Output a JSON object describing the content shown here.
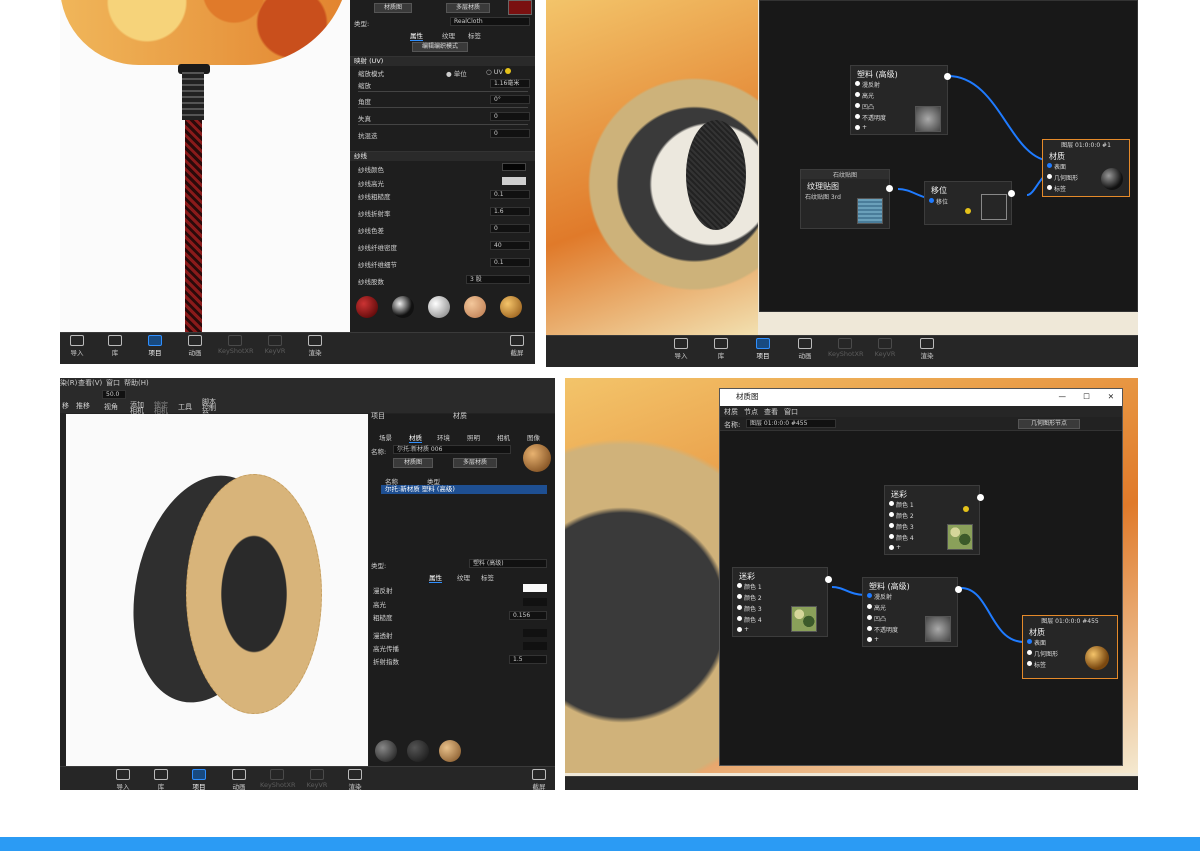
{
  "colors": {
    "accent": "#2f8fff",
    "bottom_bar": "#2b9bf4",
    "node_selected_border": "#e58a2a",
    "wire": "#1f7bff"
  },
  "p1": {
    "material_graph_btn": "材质图",
    "multilayer_btn": "多层材质",
    "type_label": "类型:",
    "type_value": "RealCloth",
    "tabs": [
      "属性",
      "纹理",
      "标签"
    ],
    "edit_weave_btn": "编辑编织模式",
    "section_mapping": "映射 (UV)",
    "scale_mode_label": "缩放模式",
    "scale_mode_opt1": "单位",
    "scale_mode_opt2": "UV",
    "rows_mapping": [
      {
        "label": "缩放",
        "value": "1.16毫米"
      },
      {
        "label": "角度",
        "value": "0°"
      },
      {
        "label": "失真",
        "value": "0"
      },
      {
        "label": "抗混迭",
        "value": "0"
      }
    ],
    "section_yarn": "纱线",
    "rows_yarn": [
      {
        "label": "纱线颜色",
        "value": ""
      },
      {
        "label": "纱线高光",
        "value": ""
      },
      {
        "label": "纱线粗糙度",
        "value": "0.1"
      },
      {
        "label": "纱线折射率",
        "value": "1.6"
      },
      {
        "label": "纱线色差",
        "value": "0"
      },
      {
        "label": "纱线纤维密度",
        "value": "40"
      },
      {
        "label": "纱线纤维细节",
        "value": "0.1"
      },
      {
        "label": "纱线股数",
        "value": "3 股"
      }
    ],
    "toolbar": [
      "导入",
      "库",
      "项目",
      "动画",
      "KeyShotXR",
      "KeyVR",
      "渲染"
    ],
    "toolbar_active": "项目",
    "screenshot_label": "截屏"
  },
  "p2": {
    "node_plastic_title": "塑料 (高级)",
    "node_plastic_ports": [
      "漫反射",
      "高光",
      "凹凸",
      "不透明度",
      "+"
    ],
    "node_texture_header": "石纹贴图",
    "node_texture_title": "纹理贴图",
    "node_texture_file": "石纹贴图 3rd",
    "node_shift_title": "移位",
    "node_shift_port": "移位",
    "node_material_header": "图层 01:0:0:0 #1",
    "node_material_title": "材质",
    "node_material_ports": [
      "表面",
      "几何图形",
      "标签"
    ],
    "toolbar": [
      "导入",
      "库",
      "项目",
      "动画",
      "KeyShotXR",
      "KeyVR",
      "渲染"
    ]
  },
  "p3": {
    "menu": [
      "染(R)",
      "查看(V)",
      "窗口",
      "帮助(H)"
    ],
    "toolbar_items": [
      "移",
      "推移",
      "视角",
      "添加相机",
      "锁定相机",
      "工具",
      "脚本控制台"
    ],
    "zoom_value": "50.0",
    "panel_left_title": "项目",
    "panel_title": "材质",
    "tabs": [
      "场景",
      "材质",
      "环境",
      "照明",
      "相机",
      "图像"
    ],
    "name_label": "名称:",
    "name_value": "尔托:新材质 006",
    "material_graph_btn": "材质图",
    "multilayer_btn": "多层材质",
    "list_headers": [
      "名称",
      "类型"
    ],
    "list_row": "尔托:新材质 塑料 (高级)",
    "type_label": "类型:",
    "type_value": "塑料 (高级)",
    "prop_tabs": [
      "属性",
      "纹理",
      "标签"
    ],
    "props": [
      {
        "label": "漫反射",
        "value": ""
      },
      {
        "label": "高光",
        "value": ""
      },
      {
        "label": "粗糙度",
        "value": "0.156"
      },
      {
        "label": "漫透射",
        "value": ""
      },
      {
        "label": "高光传播",
        "value": ""
      },
      {
        "label": "折射指数",
        "value": "1.5"
      }
    ],
    "toolbar": [
      "导入",
      "库",
      "项目",
      "动画",
      "KeyShotXR",
      "KeyVR",
      "渲染"
    ],
    "screenshot_label": "截屏"
  },
  "p4": {
    "window_title": "材质图",
    "menu": [
      "材质",
      "节点",
      "查看",
      "窗口"
    ],
    "name_label": "名称:",
    "name_value": "图层 01:0:0:0 #455",
    "geometry_node_btn": "几何图形节点",
    "node_camo1_title": "迷彩",
    "node_camo_ports": [
      "颜色 1",
      "颜色 2",
      "颜色 3",
      "颜色 4",
      "+"
    ],
    "node_camo2_title": "迷彩",
    "node_plastic_title": "塑料 (高级)",
    "node_plastic_ports": [
      "漫反射",
      "高光",
      "凹凸",
      "不透明度",
      "+"
    ],
    "node_material_header": "图层 01:0:0:0 #455",
    "node_material_title": "材质",
    "node_material_ports": [
      "表面",
      "几何图形",
      "标签"
    ]
  }
}
